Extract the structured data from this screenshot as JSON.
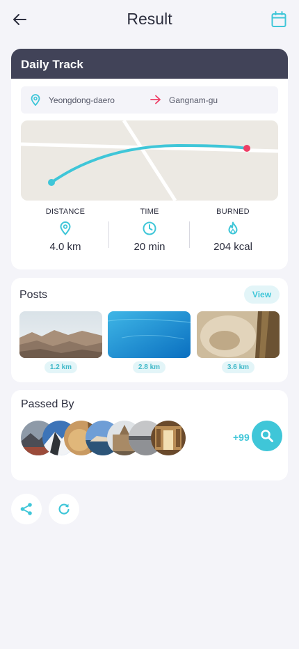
{
  "header": {
    "title": "Result",
    "back_icon": "arrow-left-icon",
    "calendar_icon": "calendar-icon"
  },
  "colors": {
    "accent": "#3fc6d8",
    "header_bar": "#414358",
    "route_end": "#ee3f66",
    "background": "#f4f4f9"
  },
  "track": {
    "title": "Daily Track",
    "from": "Yeongdong-daero",
    "to": "Gangnam-gu",
    "stats": [
      {
        "label": "DISTANCE",
        "icon": "location-pin-icon",
        "value": "4.0 km"
      },
      {
        "label": "TIME",
        "icon": "clock-icon",
        "value": "20 min"
      },
      {
        "label": "BURNED",
        "icon": "flame-icon",
        "value": "204 kcal"
      }
    ]
  },
  "posts": {
    "title": "Posts",
    "view_label": "View",
    "items": [
      {
        "distance": "1.2 km",
        "image": "desert-mountains-photo"
      },
      {
        "distance": "2.8 km",
        "image": "blue-sea-photo"
      },
      {
        "distance": "3.6 km",
        "image": "stone-wall-photo"
      }
    ]
  },
  "passed_by": {
    "title": "Passed By",
    "more_count": "+99",
    "avatars": [
      "lake-mountain",
      "snow-peak",
      "desert-rock",
      "coastal-town",
      "city-cathedral",
      "misty-river",
      "ornate-hall"
    ]
  },
  "actions": {
    "share_icon": "share-icon",
    "refresh_icon": "refresh-icon"
  }
}
